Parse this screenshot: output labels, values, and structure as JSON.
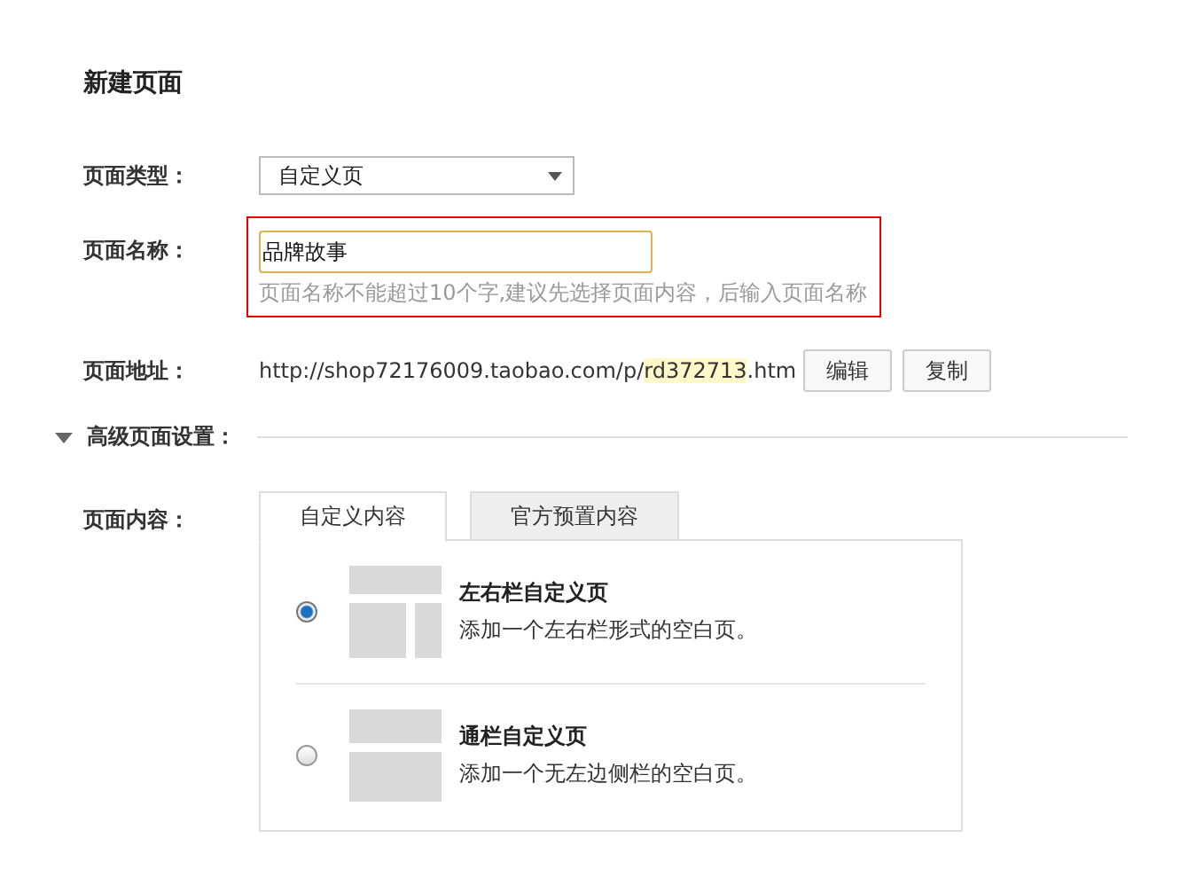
{
  "title": "新建页面",
  "page_type": {
    "label": "页面类型：",
    "value": "自定义页"
  },
  "page_name": {
    "label": "页面名称：",
    "value": "品牌故事",
    "hint": "页面名称不能超过10个字,建议先选择页面内容，后输入页面名称",
    "highlighted": true
  },
  "page_address": {
    "label": "页面地址：",
    "parts": [
      {
        "text": "http://shop72176009.taobao.com/p/",
        "highlighted": false
      },
      {
        "text": "rd372713",
        "highlighted": true
      },
      {
        "text": ".htm",
        "highlighted": false
      }
    ],
    "buttons": [
      "编辑",
      "复制"
    ]
  },
  "advanced": {
    "label": "高级页面设置：",
    "expanded": true
  },
  "page_content": {
    "label": "页面内容：",
    "tabs": [
      {
        "label": "自定义内容",
        "selected": true
      },
      {
        "label": "官方预置内容",
        "selected": false
      }
    ],
    "options": [
      {
        "kind": "two-column",
        "title": "左右栏自定义页",
        "description": "添加一个左右栏形式的空白页。",
        "selected": true
      },
      {
        "kind": "full-width",
        "title": "通栏自定义页",
        "description": "添加一个无左边侧栏的空白页。",
        "selected": false
      }
    ]
  }
}
